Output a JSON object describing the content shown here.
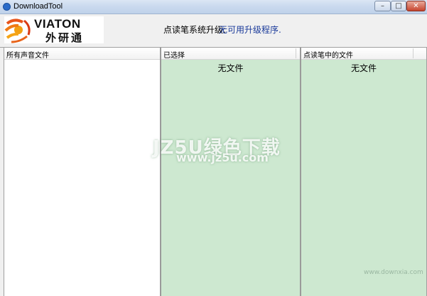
{
  "window": {
    "title": "DownloadTool",
    "minimize_glyph": "–",
    "maximize_glyph": "□",
    "close_glyph": "✕"
  },
  "header": {
    "logo_brand": "VIATON",
    "logo_cn": "外研通",
    "upgrade_label": "点读笔系统升级:",
    "upgrade_status": "无可用升级程序."
  },
  "panes": [
    {
      "title": "所有声音文件",
      "empty_text": ""
    },
    {
      "title": "已选择",
      "empty_text": "无文件"
    },
    {
      "title": "点读笔中的文件",
      "empty_text": "无文件"
    }
  ],
  "watermark": {
    "text": "JZ5U绿色下载",
    "url": "www.jz5u.com",
    "corner": "www.downxia.com"
  },
  "colors": {
    "pane_bg_green": "#cde8d0",
    "upgrade_status_color": "#1a3a9a"
  },
  "icons": [
    "app-icon",
    "viaton-logo-icon"
  ]
}
